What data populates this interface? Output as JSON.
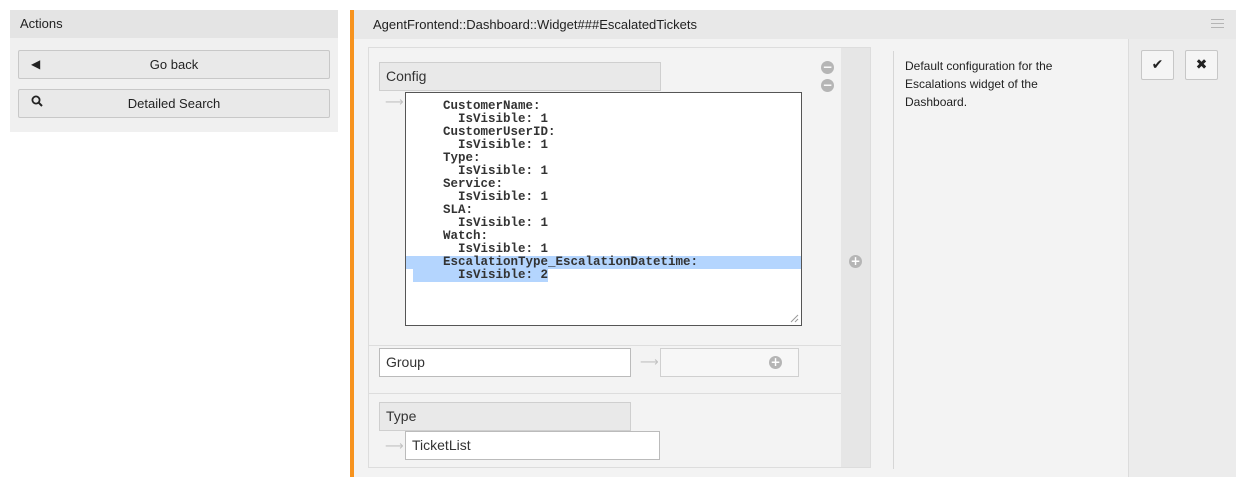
{
  "sidebar": {
    "title": "Actions",
    "go_back_label": "Go back",
    "search_label": "Detailed Search"
  },
  "setting": {
    "title": "AgentFrontend::Dashboard::Widget###EscalatedTickets",
    "description": "Default configuration for the Escalations widget of the Dashboard."
  },
  "config": {
    "label": "Config",
    "lines": [
      "CustomerName:",
      "  IsVisible: 1",
      "CustomerUserID:",
      "  IsVisible: 1",
      "Type:",
      "  IsVisible: 1",
      "Service:",
      "  IsVisible: 1",
      "SLA:",
      "  IsVisible: 1",
      "Watch:",
      "  IsVisible: 1",
      "EscalationType_EscalationDatetime:",
      "  IsVisible: 2"
    ],
    "selected_lines": [
      12,
      13
    ]
  },
  "group": {
    "label": "Group",
    "value": ""
  },
  "type": {
    "label": "Type",
    "value": "TicketList"
  },
  "icons": {
    "go_back": "caret-left-icon",
    "search": "search-icon",
    "menu": "hamburger-menu-icon",
    "save": "checkmark-icon",
    "cancel": "close-icon"
  },
  "colors": {
    "accent": "#f7931e",
    "selection": "#b4d5fe"
  }
}
